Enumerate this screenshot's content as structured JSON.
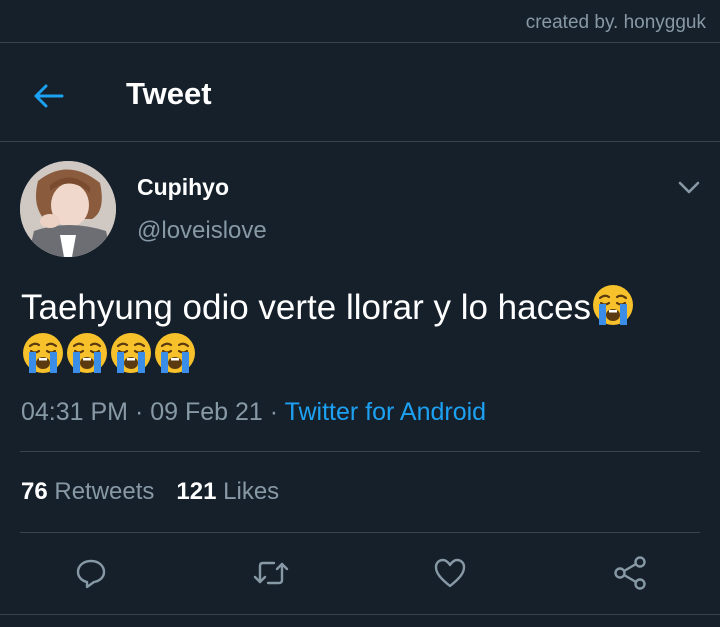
{
  "credit": "created by. honygguk",
  "header": {
    "title": "Tweet",
    "back_icon": "arrow-left-icon"
  },
  "colors": {
    "background": "#15202b",
    "accent": "#1da1f2",
    "secondary_text": "#8899a6",
    "divider": "#38444d"
  },
  "tweet": {
    "display_name": "Cupihyo",
    "handle": "@loveislove",
    "text_main": "Taehyung odio verte llorar y lo haces",
    "emoji_name": "loudly-crying-face",
    "emoji_count": 5,
    "time": "04:31 PM",
    "date": "09 Feb 21",
    "source": "Twitter for Android"
  },
  "stats": {
    "retweets_count": "76",
    "retweets_label": "Retweets",
    "likes_count": "121",
    "likes_label": "Likes"
  },
  "actions": [
    "reply-icon",
    "retweet-icon",
    "like-icon",
    "share-icon"
  ]
}
